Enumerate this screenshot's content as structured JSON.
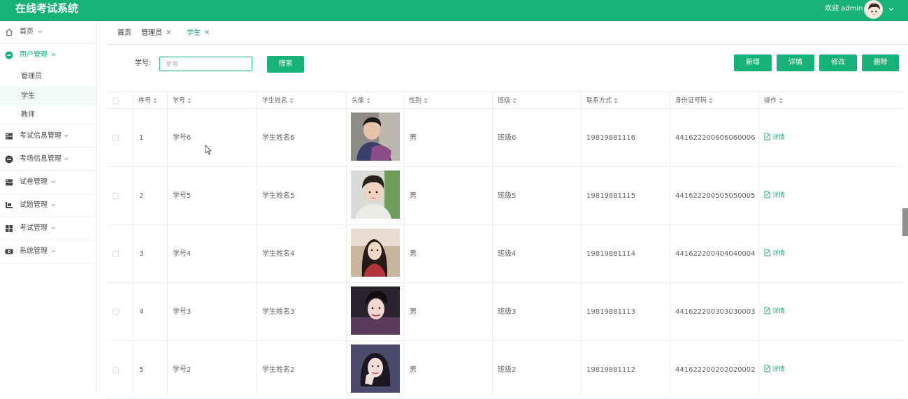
{
  "app": {
    "title": "在线考试系统",
    "welcome": "欢迎 admin"
  },
  "sidebar": {
    "items": [
      {
        "label": "首页",
        "icon": "home-icon"
      },
      {
        "label": "用户管理",
        "icon": "user-group-icon",
        "expanded": true,
        "children": [
          {
            "label": "管理员"
          },
          {
            "label": "学生",
            "selected": true
          },
          {
            "label": "教师"
          }
        ]
      },
      {
        "label": "考试信息管理",
        "icon": "server-icon"
      },
      {
        "label": "考场信息管理",
        "icon": "room-icon"
      },
      {
        "label": "试卷管理",
        "icon": "paper-icon"
      },
      {
        "label": "试题管理",
        "icon": "question-icon"
      },
      {
        "label": "考试管理",
        "icon": "grid-icon"
      },
      {
        "label": "系统管理",
        "icon": "eye-icon"
      }
    ]
  },
  "breadcrumb": {
    "home": "首页",
    "tabs": [
      {
        "label": "管理员",
        "close": "×"
      },
      {
        "label": "学生",
        "close": "×",
        "active": true
      }
    ]
  },
  "search": {
    "label": "学号:",
    "placeholder": "学号",
    "button": "搜索"
  },
  "actions": {
    "add": "新增",
    "detail": "详情",
    "edit": "修改",
    "delete": "删除"
  },
  "colors": {
    "primary": "#17b27a"
  },
  "table": {
    "columns": [
      "序号",
      "学号",
      "学生姓名",
      "头像",
      "性别",
      "班级",
      "联系方式",
      "身份证号码",
      "操作"
    ],
    "rows": [
      {
        "no": "1",
        "sid": "学号6",
        "name": "学生姓名6",
        "gender": "男",
        "class": "班级6",
        "phone": "19819881116",
        "idcard": "441622200606060006",
        "action": "详情"
      },
      {
        "no": "2",
        "sid": "学号5",
        "name": "学生姓名5",
        "gender": "男",
        "class": "班级5",
        "phone": "19819881115",
        "idcard": "441622200505050005",
        "action": "详情"
      },
      {
        "no": "3",
        "sid": "学号4",
        "name": "学生姓名4",
        "gender": "男",
        "class": "班级4",
        "phone": "19819881114",
        "idcard": "441622200404040004",
        "action": "详情"
      },
      {
        "no": "4",
        "sid": "学号3",
        "name": "学生姓名3",
        "gender": "男",
        "class": "班级3",
        "phone": "19819881113",
        "idcard": "441622200303030003",
        "action": "详情"
      },
      {
        "no": "5",
        "sid": "学号2",
        "name": "学生姓名2",
        "gender": "男",
        "class": "班级2",
        "phone": "19819881112",
        "idcard": "441622200202020002",
        "action": "详情"
      }
    ]
  }
}
